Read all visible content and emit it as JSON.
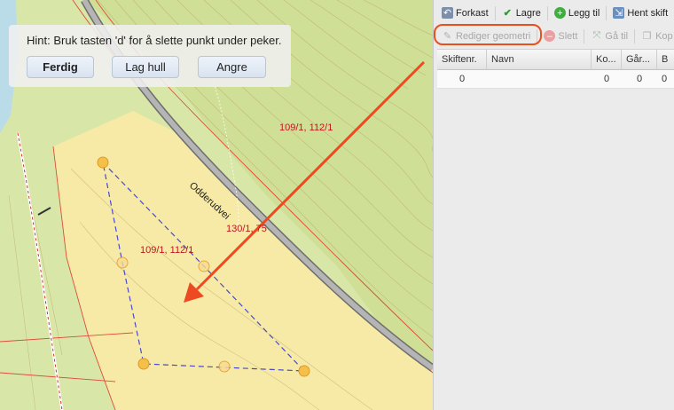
{
  "map": {
    "hint": "Hint: Bruk tasten 'd' for å slette punkt under peker.",
    "buttons": {
      "finish": "Ferdig",
      "hole": "Lag hull",
      "undo": "Angre"
    },
    "labels": {
      "parcel_top": "109/1, 112/1",
      "parcel_mid": "109/1, 112/1",
      "road_parcel": "130/1, 75",
      "road_name": "Odderudvei"
    }
  },
  "toolbar": {
    "discard": "Forkast",
    "save": "Lagre",
    "add": "Legg til",
    "fetch": "Hent skift",
    "edit_geometry": "Rediger geometri",
    "delete": "Slett",
    "goto": "Gå til",
    "copy": "Kop"
  },
  "grid": {
    "columns": [
      "Skiftenr.",
      "Navn",
      "Ko...",
      "Går...",
      "B"
    ],
    "rows": [
      {
        "skiftenr": "0",
        "navn": "",
        "ko": "0",
        "gar": "0",
        "b": "0"
      }
    ]
  },
  "colors": {
    "accent": "#e9501c",
    "parcel_label": "#c0161c"
  }
}
